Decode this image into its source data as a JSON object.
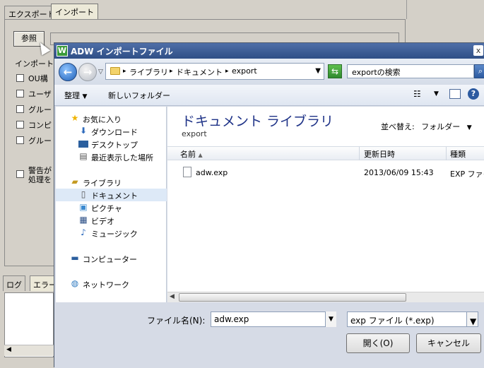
{
  "background_app": {
    "tabs": [
      "エクスポート",
      "インポート"
    ],
    "browse_button": "参照",
    "import_heading": "インポート",
    "options": [
      "OU構",
      "ユーザ",
      "グルー",
      "コンピ",
      "グルー"
    ],
    "warning_lines": [
      "警告が",
      "処理を"
    ],
    "log_tabs": [
      "ログ",
      "エラー"
    ]
  },
  "dialog": {
    "app_icon": "W",
    "title": "ADW インポートファイル",
    "close_label": "x",
    "breadcrumbs": [
      "ライブラリ",
      "ドキュメント",
      "export"
    ],
    "search_placeholder": "exportの検索",
    "toolbar": {
      "organize": "整理",
      "new_folder": "新しいフォルダー"
    },
    "nav_pane": {
      "favorites": "お気に入り",
      "downloads": "ダウンロード",
      "desktop": "デスクトップ",
      "recent": "最近表示した場所",
      "libraries": "ライブラリ",
      "documents": "ドキュメント",
      "pictures": "ピクチャ",
      "videos": "ビデオ",
      "music": "ミュージック",
      "computer": "コンピューター",
      "network": "ネットワーク"
    },
    "library_title": "ドキュメント ライブラリ",
    "library_subtitle": "export",
    "sort_by_label": "並べ替え:",
    "sort_by_value": "フォルダー",
    "columns": [
      "名前",
      "更新日時",
      "種類"
    ],
    "files": [
      {
        "name": "adw.exp",
        "modified": "2013/06/09 15:43",
        "type": "EXP ファイ"
      }
    ],
    "filename_label": "ファイル名(N):",
    "filename_value": "adw.exp",
    "filetype_value": "exp ファイル (*.exp)",
    "open_button": "開く(O)",
    "cancel_button": "キャンセル"
  }
}
